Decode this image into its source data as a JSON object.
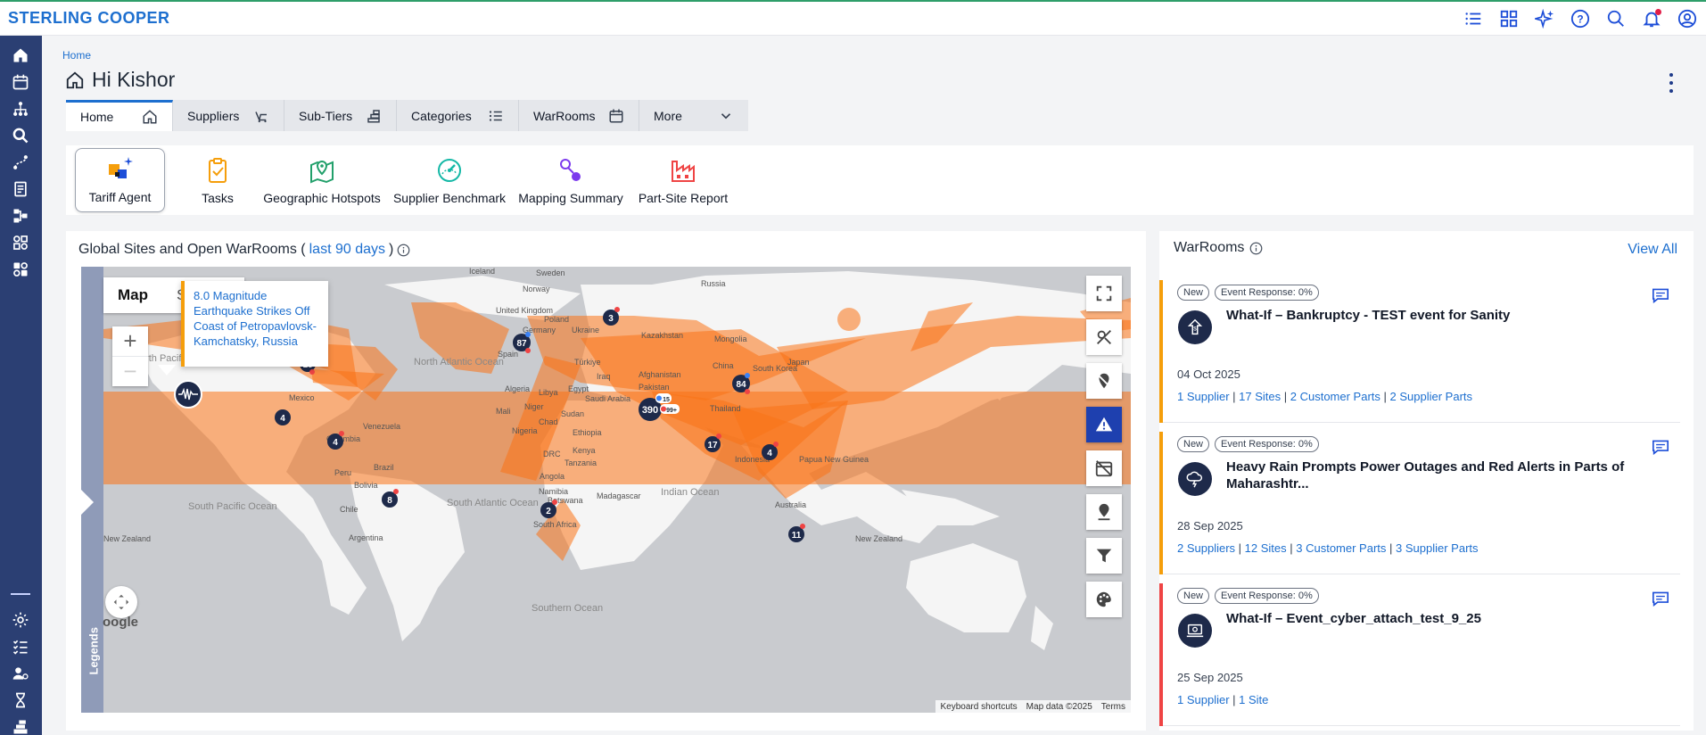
{
  "app": {
    "brand": "STERLING COOPER"
  },
  "header": {
    "breadcrumb": "Home",
    "greeting": "Hi Kishor"
  },
  "tabs": [
    {
      "label": "Home",
      "icon": "home-icon"
    },
    {
      "label": "Suppliers",
      "icon": "supplier-icon"
    },
    {
      "label": "Sub-Tiers",
      "icon": "subtier-icon"
    },
    {
      "label": "Categories",
      "icon": "list-icon"
    },
    {
      "label": "WarRooms",
      "icon": "calendar-icon"
    },
    {
      "label": "More",
      "icon": "chevron-down-icon"
    }
  ],
  "quick_links": [
    {
      "label": "Tariff Agent",
      "icon": "tariff-agent-icon"
    },
    {
      "label": "Tasks",
      "icon": "clipboard-icon"
    },
    {
      "label": "Geographic Hotspots",
      "icon": "map-pin-icon"
    },
    {
      "label": "Supplier Benchmark",
      "icon": "gauge-icon"
    },
    {
      "label": "Mapping Summary",
      "icon": "mapping-icon"
    },
    {
      "label": "Part-Site Report",
      "icon": "factory-icon"
    }
  ],
  "map_panel": {
    "title_prefix": "Global Sites and Open WarRooms (",
    "title_link": "last 90 days",
    "title_suffix": ")",
    "map_types": [
      "Map",
      "Satellite"
    ],
    "popup_text": "8.0 Magnitude Earthquake Strikes Off Coast of Petropavlovsk-Kamchatsky, Russia",
    "legends_label": "Legends",
    "google_label": "oogle",
    "attribution": [
      "Keyboard shortcuts",
      "Map data ©2025",
      "Terms"
    ],
    "clusters": [
      "18",
      "4",
      "4",
      "8",
      "87",
      "3",
      "390",
      "17",
      "84",
      "4",
      "2",
      "11"
    ],
    "cluster_badges": [
      "15",
      "99+"
    ],
    "place_labels": {
      "iceland": "Iceland",
      "sweden": "Sweden",
      "russia": "Russia",
      "norway": "Norway",
      "united_kingdom": "United Kingdom",
      "poland": "Poland",
      "germany": "Germany",
      "ukraine": "Ukraine",
      "kazakhstan": "Kazakhstan",
      "mongolia": "Mongolia",
      "spain": "Spain",
      "turkiye": "Türkiye",
      "north_atlantic": "North Atlantic Ocean",
      "north_pacific": "North Pacific Ocean",
      "mexico": "Mexico",
      "algeria": "Algeria",
      "libya": "Libya",
      "egypt": "Egypt",
      "iraq": "Iraq",
      "afghanistan": "Afghanistan",
      "pakistan": "Pakistan",
      "china": "China",
      "south_korea": "South Korea",
      "japan": "Japan",
      "saudi": "Saudi Arabia",
      "thailand": "Thailand",
      "mali": "Mali",
      "niger": "Niger",
      "sudan": "Sudan",
      "chad": "Chad",
      "nigeria": "Nigeria",
      "ethiopia": "Ethiopia",
      "venezuela": "Venezuela",
      "colombia": "Colombia",
      "kenya": "Kenya",
      "drc": "DRC",
      "tanzania": "Tanzania",
      "indonesia": "Indonesia",
      "png": "Papua New Guinea",
      "peru": "Peru",
      "brazil": "Brazil",
      "bolivia": "Bolivia",
      "angola": "Angola",
      "namibia": "Namibia",
      "madagascar": "Madagascar",
      "indian_ocean": "Indian Ocean",
      "botswana": "Botswana",
      "south_africa": "South Africa",
      "south_pacific": "South Pacific Ocean",
      "south_atlantic": "South Atlantic Ocean",
      "chile": "Chile",
      "argentina": "Argentina",
      "australia": "Australia",
      "new_zealand": "New Zealand",
      "new_zealand_left": "New Zealand",
      "southern": "Southern Ocean"
    }
  },
  "warrooms": {
    "title": "WarRooms",
    "view_all": "View All",
    "items": [
      {
        "badges": [
          "New",
          "Event Response: 0%"
        ],
        "name": "What-If – Bankruptcy - TEST event for Sanity",
        "date": "04 Oct 2025",
        "links": [
          "1 Supplier",
          "17 Sites",
          "2 Customer Parts",
          "2 Supplier Parts"
        ],
        "bar_color": "#f59e0b",
        "icon": "bankruptcy-icon"
      },
      {
        "badges": [
          "New",
          "Event Response: 0%"
        ],
        "name": "Heavy Rain Prompts Power Outages and Red Alerts in Parts of Maharashtr...",
        "date": "28 Sep 2025",
        "links": [
          "2 Suppliers",
          "12 Sites",
          "3 Customer Parts",
          "3 Supplier Parts"
        ],
        "bar_color": "#f59e0b",
        "icon": "storm-icon"
      },
      {
        "badges": [
          "New",
          "Event Response: 0%"
        ],
        "name": "What-If – Event_cyber_attach_test_9_25",
        "date": "25 Sep 2025",
        "links": [
          "1 Supplier",
          "1 Site"
        ],
        "bar_color": "#ef4444",
        "icon": "cyber-attack-icon"
      }
    ]
  },
  "colors": {
    "accent": "#1d6fcf",
    "rail": "#2b3f73",
    "warning": "#f59e0b",
    "danger": "#ef4444",
    "overlay": "#f97316"
  }
}
